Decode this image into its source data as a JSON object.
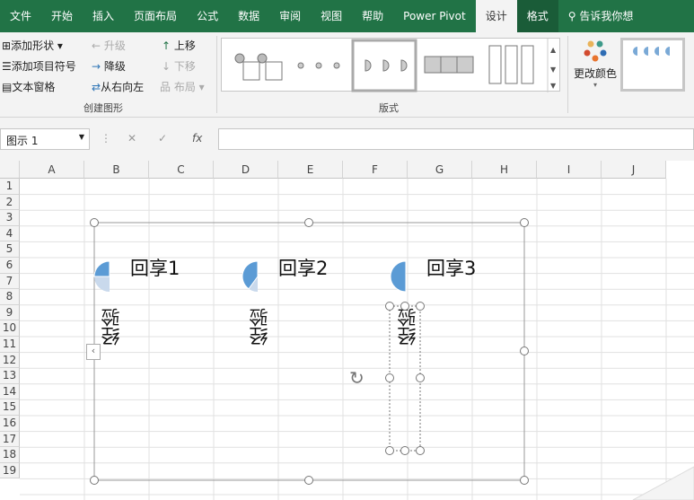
{
  "tabs": [
    "文件",
    "开始",
    "插入",
    "页面布局",
    "公式",
    "数据",
    "审阅",
    "视图",
    "帮助",
    "Power Pivot",
    "设计",
    "格式"
  ],
  "search": "告诉我你想",
  "ribbon": {
    "add_shape": "添加形状",
    "add_bullet": "添加项目符号",
    "text_pane": "文本窗格",
    "promote": "升级",
    "demote": "降级",
    "rtl": "从右向左",
    "move_up": "上移",
    "move_down": "下移",
    "layout": "布局",
    "group_create": "创建图形",
    "group_layouts": "版式",
    "change_colors": "更改颜色"
  },
  "namebox": "图示 1",
  "fx": "fx",
  "columns": [
    "A",
    "B",
    "C",
    "D",
    "E",
    "F",
    "G",
    "H",
    "I",
    "J"
  ],
  "rows": [
    "1",
    "2",
    "3",
    "4",
    "5",
    "6",
    "7",
    "8",
    "9",
    "10",
    "11",
    "12",
    "13",
    "14",
    "15",
    "16",
    "17",
    "18",
    "19"
  ],
  "smartart": {
    "items": [
      {
        "title": "回享1",
        "text": "经验",
        "fill": 0.25
      },
      {
        "title": "回享2",
        "text": "经验",
        "fill": 0.4
      },
      {
        "title": "回享3",
        "text": "经验",
        "fill": 0.5
      }
    ]
  },
  "colors": {
    "ribbon": "#217346",
    "accent": "#5b9bd5",
    "light": "#c9d9ec"
  }
}
